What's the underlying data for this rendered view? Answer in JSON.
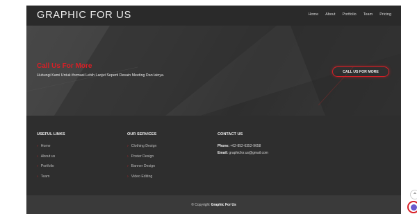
{
  "header": {
    "brand": "GRAPHIC FOR US",
    "nav": [
      "Home",
      "About",
      "Portfolio",
      "Team",
      "Pricing"
    ]
  },
  "cta": {
    "title": "Call Us For More",
    "subtitle": "Hubungi Kami Untuk iformasi Lebih Lanjut Seperti Desain Meeting Dan lainya.",
    "button": "CALL US FOR MORE"
  },
  "footer": {
    "useful_links": {
      "heading": "USEFUL LINKS",
      "items": [
        "Home",
        "About us",
        "Portfolio",
        "Team"
      ]
    },
    "services": {
      "heading": "OUR SERVICES",
      "items": [
        "Clothing Design",
        "Poster Design",
        "Banner Design",
        "Video Editing"
      ]
    },
    "contact": {
      "heading": "CONTACT US",
      "phone_label": "Phone:",
      "phone": "+62-852-6352-9658",
      "email_label": "Email:",
      "email": "graphicfor.us@gmail.com"
    }
  },
  "copyright": {
    "prefix": "© Copyright",
    "name": "Graphic For Us"
  },
  "colors": {
    "accent": "#d81f26",
    "background": "#2c2c2c",
    "text": "#f0f0f0"
  },
  "icons": {
    "list_bullet": "chevron-right-icon",
    "scroll_top": "arrow-up-icon",
    "chat": "chat-widget-icon"
  }
}
